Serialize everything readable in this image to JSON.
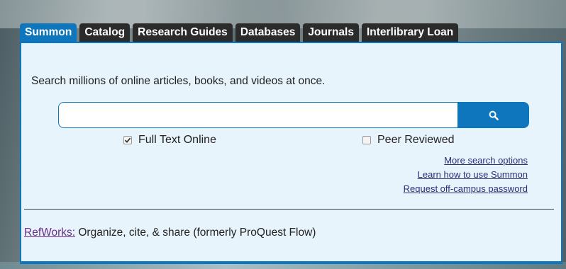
{
  "tabs": [
    {
      "label": "Summon",
      "active": true
    },
    {
      "label": "Catalog",
      "active": false
    },
    {
      "label": "Research Guides",
      "active": false
    },
    {
      "label": "Databases",
      "active": false
    },
    {
      "label": "Journals",
      "active": false
    },
    {
      "label": "Interlibrary Loan",
      "active": false
    }
  ],
  "panel": {
    "intro": "Search millions of online articles, books, and videos at once.",
    "search": {
      "value": "",
      "placeholder": "",
      "button_icon": "search-icon"
    },
    "filters": {
      "full_text": {
        "label": "Full Text Online",
        "checked": true
      },
      "peer_reviewed": {
        "label": "Peer Reviewed",
        "checked": false
      }
    },
    "links": [
      "More search options",
      "Learn how to use Summon",
      "Request off-campus password"
    ],
    "refworks": {
      "link": "RefWorks:",
      "text": " Organize, cite, & share (formerly ProQuest Flow)"
    }
  },
  "colors": {
    "accent": "#0e76bc",
    "tab_inactive": "#2b2b2b",
    "panel_bg": "#e8f4fb",
    "link": "#2d2d7a",
    "visited_link": "#6a2e8c"
  }
}
